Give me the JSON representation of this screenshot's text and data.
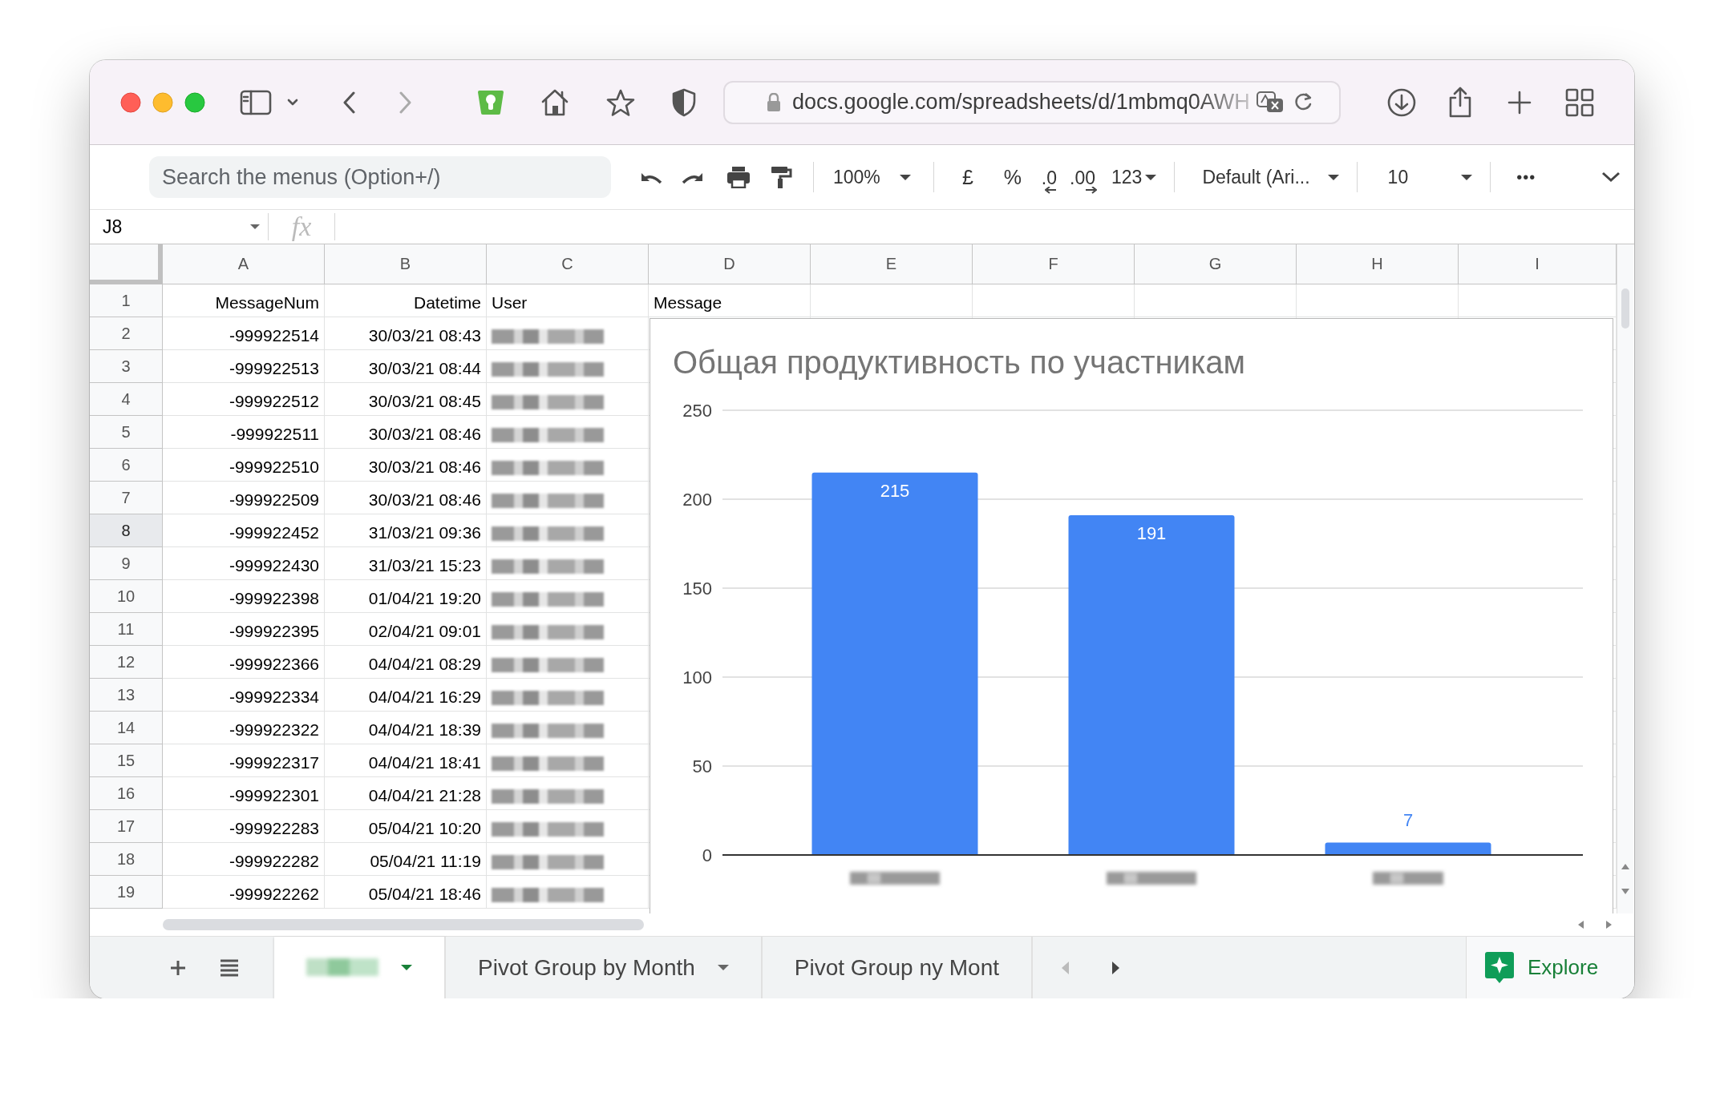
{
  "browser": {
    "url": "docs.google.com/spreadsheets/d/1mbmq0AWH"
  },
  "toolbar": {
    "search": {
      "placeholder": "Search the menus (Option+/)"
    },
    "zoom": "100%",
    "currency": "£",
    "percent": "%",
    "decrease_decimals": ".0",
    "increase_decimals": ".00",
    "number_format": "123",
    "font": "Default (Ari...",
    "font_size": "10",
    "more": "•••"
  },
  "formula_bar": {
    "cell_ref": "J8",
    "fx": "fx"
  },
  "columns": [
    "A",
    "B",
    "C",
    "D",
    "E",
    "F",
    "G",
    "H",
    "I"
  ],
  "header_row": {
    "number": "1",
    "selected": false,
    "cells": [
      "MessageNum",
      "Datetime",
      "User",
      "Message"
    ]
  },
  "rows": [
    {
      "number": "2",
      "selected": false,
      "message_num": "-999922514",
      "datetime": "30/03/21 08:43",
      "user": {
        "kind": "redacted"
      }
    },
    {
      "number": "3",
      "selected": false,
      "message_num": "-999922513",
      "datetime": "30/03/21 08:44",
      "user": {
        "kind": "redacted"
      }
    },
    {
      "number": "4",
      "selected": false,
      "message_num": "-999922512",
      "datetime": "30/03/21 08:45",
      "user": {
        "kind": "redacted"
      }
    },
    {
      "number": "5",
      "selected": false,
      "message_num": "-999922511",
      "datetime": "30/03/21 08:46",
      "user": {
        "kind": "redacted"
      }
    },
    {
      "number": "6",
      "selected": false,
      "message_num": "-999922510",
      "datetime": "30/03/21 08:46",
      "user": {
        "kind": "redacted"
      }
    },
    {
      "number": "7",
      "selected": false,
      "message_num": "-999922509",
      "datetime": "30/03/21 08:46",
      "user": {
        "kind": "redacted"
      }
    },
    {
      "number": "8",
      "selected": true,
      "message_num": "-999922452",
      "datetime": "31/03/21 09:36",
      "user": {
        "kind": "redacted"
      }
    },
    {
      "number": "9",
      "selected": false,
      "message_num": "-999922430",
      "datetime": "31/03/21 15:23",
      "user": {
        "kind": "redacted"
      }
    },
    {
      "number": "10",
      "selected": false,
      "message_num": "-999922398",
      "datetime": "01/04/21 19:20",
      "user": {
        "kind": "redacted"
      }
    },
    {
      "number": "11",
      "selected": false,
      "message_num": "-999922395",
      "datetime": "02/04/21 09:01",
      "user": {
        "kind": "redacted"
      }
    },
    {
      "number": "12",
      "selected": false,
      "message_num": "-999922366",
      "datetime": "04/04/21 08:29",
      "user": {
        "kind": "redacted"
      }
    },
    {
      "number": "13",
      "selected": false,
      "message_num": "-999922334",
      "datetime": "04/04/21 16:29",
      "user": {
        "kind": "redacted"
      }
    },
    {
      "number": "14",
      "selected": false,
      "message_num": "-999922322",
      "datetime": "04/04/21 18:39",
      "user": {
        "kind": "redacted"
      }
    },
    {
      "number": "15",
      "selected": false,
      "message_num": "-999922317",
      "datetime": "04/04/21 18:41",
      "user": {
        "kind": "redacted"
      }
    },
    {
      "number": "16",
      "selected": false,
      "message_num": "-999922301",
      "datetime": "04/04/21 21:28",
      "user": {
        "kind": "redacted"
      }
    },
    {
      "number": "17",
      "selected": false,
      "message_num": "-999922283",
      "datetime": "05/04/21 10:20",
      "user": {
        "kind": "redacted"
      }
    },
    {
      "number": "18",
      "selected": false,
      "message_num": "-999922282",
      "datetime": "05/04/21 11:19",
      "user": {
        "kind": "redacted"
      }
    },
    {
      "number": "19",
      "selected": false,
      "message_num": "-999922262",
      "datetime": "05/04/21 18:46",
      "user": {
        "kind": "redacted"
      }
    }
  ],
  "chart": {
    "category_labels": {
      "kind": "redacted"
    },
    "chart_data": {
      "type": "bar",
      "title": "Общая продуктивность по участникам",
      "series": [
        {
          "color": "#4285f4",
          "values": [
            215,
            191,
            7
          ]
        }
      ],
      "ylim": [
        0,
        250
      ],
      "grid": true,
      "yticks": [
        0,
        50,
        100,
        150,
        200,
        250
      ],
      "data_labels": true
    }
  },
  "sheet_tabs": [
    {
      "kind": "redacted",
      "selected": true
    },
    {
      "kind": "named",
      "label": "Pivot Group by Month",
      "selected": false
    },
    {
      "kind": "named",
      "label": "Pivot Group ny Mont",
      "selected": false
    }
  ],
  "explore": {
    "label": "Explore"
  }
}
